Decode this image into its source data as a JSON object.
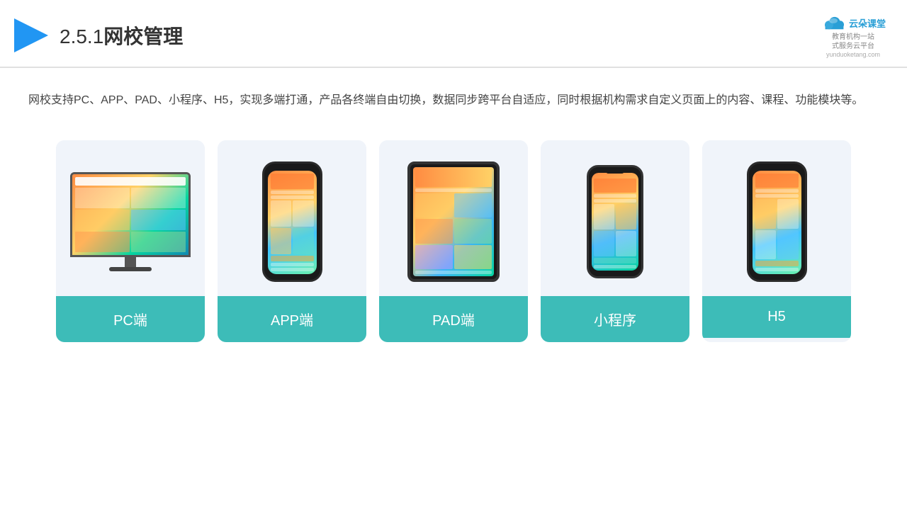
{
  "header": {
    "title": "网校管理",
    "number": "2.5.1",
    "logo_name": "云朵课堂",
    "logo_url": "yunduoketang.com",
    "logo_tagline": "教育机构一站\n式服务云平台"
  },
  "description": {
    "text": "网校支持PC、APP、PAD、小程序、H5，实现多端打通，产品各终端自由切换，数据同步跨平台自适应，同时根据机构需求自定义页面上的内容、课程、功能模块等。"
  },
  "cards": [
    {
      "id": "pc",
      "label": "PC端"
    },
    {
      "id": "app",
      "label": "APP端"
    },
    {
      "id": "pad",
      "label": "PAD端"
    },
    {
      "id": "miniprogram",
      "label": "小程序"
    },
    {
      "id": "h5",
      "label": "H5"
    }
  ],
  "colors": {
    "accent": "#3dbcb8",
    "text_primary": "#333333",
    "text_secondary": "#444444",
    "bg_card": "#f0f4fa",
    "header_border": "#e0e0e0"
  }
}
